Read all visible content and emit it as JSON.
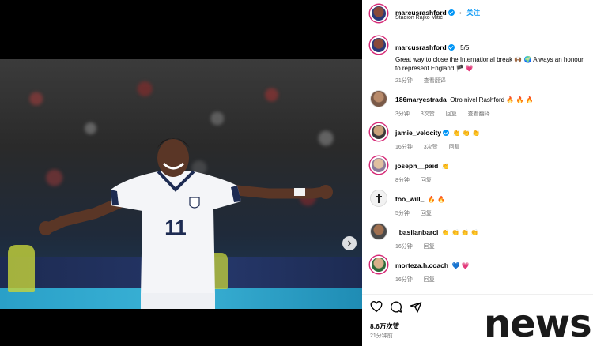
{
  "header": {
    "username": "marcusrashford",
    "separator": "•",
    "follow_label": "关注",
    "location": "Stadion Rajko Mitić"
  },
  "caption": {
    "username": "marcusrashford",
    "counter": "5/5",
    "text": "Great way to close the International break 🙌🏾 🌍 Always an honour to represent England 🏴 💗",
    "time": "21分钟",
    "translate_label": "查看翻译"
  },
  "comments": [
    {
      "username": "186maryestrada",
      "text": "Otro nivel Rashford 🔥 🔥 🔥",
      "time": "3分钟",
      "likes": "3次赞",
      "reply": "回复",
      "translate": "查看翻译",
      "verified": false
    },
    {
      "username": "jamie_velocity",
      "text": "👏 👏 👏",
      "time": "16分钟",
      "likes": "3次赞",
      "reply": "回复",
      "verified": true
    },
    {
      "username": "joseph__paid",
      "text": "👏",
      "time": "8分钟",
      "reply": "回复",
      "verified": false
    },
    {
      "username": "too_will_",
      "text": "🔥 🔥",
      "time": "5分钟",
      "reply": "回复",
      "verified": false
    },
    {
      "username": "_basilanbarci",
      "text": "👏 👏 👏 👏",
      "time": "16分钟",
      "reply": "回复",
      "verified": false
    },
    {
      "username": "morteza.h.coach",
      "text": "💙 💗",
      "time": "16分钟",
      "reply": "回复",
      "verified": false
    }
  ],
  "actions": {
    "likes_label": "8.6万次赞",
    "time_label": "21分钟前",
    "icons": [
      "heart-icon",
      "comment-icon",
      "share-icon"
    ]
  },
  "media": {
    "jersey_number": "11"
  },
  "watermark": "news",
  "colors": {
    "verified": "#0095f6",
    "story_ring": "#d62976",
    "follow": "#0095f6"
  }
}
